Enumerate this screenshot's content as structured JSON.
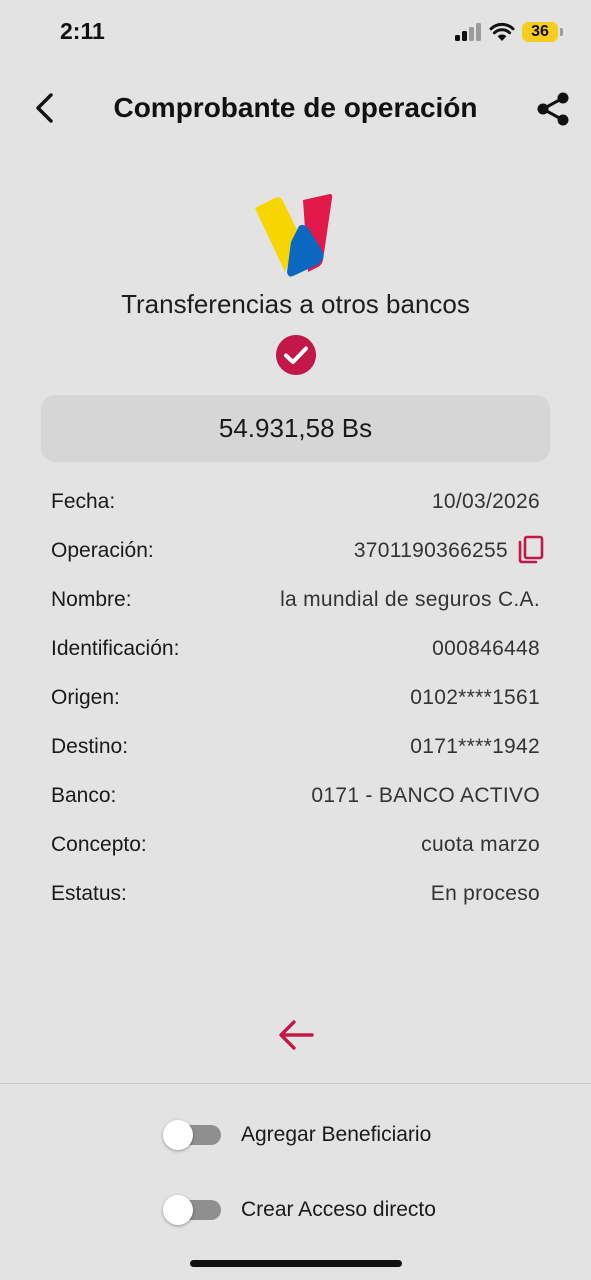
{
  "status_bar": {
    "time": "2:11",
    "battery": "36"
  },
  "header": {
    "title": "Comprobante de operación",
    "back_icon": "chevron-left-icon",
    "share_icon": "share-icon"
  },
  "receipt": {
    "logo": "bank-logo",
    "transaction_type": "Transferencias a otros bancos",
    "status_icon": "check-circle-icon",
    "amount": "54.931,58 Bs",
    "details": [
      {
        "label": "Fecha:",
        "value": "10/03/2026"
      },
      {
        "label": "Operación:",
        "value": "3701190366255"
      },
      {
        "label": "Nombre:",
        "value": "la mundial de seguros C.A."
      },
      {
        "label": "Identificación:",
        "value": "000846448"
      },
      {
        "label": "Origen:",
        "value": "0102****1561"
      },
      {
        "label": "Destino:",
        "value": "0171****1942"
      },
      {
        "label": "Banco:",
        "value": "0171 - BANCO ACTIVO"
      },
      {
        "label": "Concepto:",
        "value": "cuota marzo"
      },
      {
        "label": "Estatus:",
        "value": "En proceso"
      }
    ]
  },
  "actions": {
    "back_icon": "arrow-left-icon",
    "add_beneficiary": {
      "label": "Agregar Beneficiario",
      "enabled": false
    },
    "create_shortcut": {
      "label": "Crear Acceso directo",
      "enabled": false
    }
  },
  "colors": {
    "accent": "#c3174a",
    "background": "#e3e3e3",
    "amount_box": "#d6d6d6",
    "logo_yellow": "#f7d500",
    "logo_red": "#e1194b",
    "logo_blue": "#0a68c1"
  }
}
